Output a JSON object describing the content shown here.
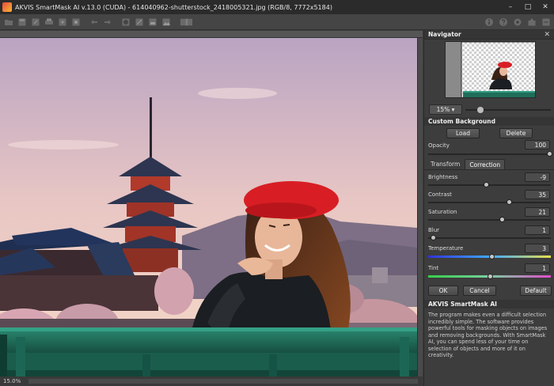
{
  "window": {
    "title": "AKVIS SmartMask AI v.13.0 (CUDA) - 614040962-shutterstock_2418005321.jpg (RGB/8, 7772x5184)",
    "minimize": "–",
    "maximize": "□",
    "close": "✕"
  },
  "toolbar": {
    "left_icons": [
      "open-icon",
      "save-icon",
      "save-as-icon",
      "print-icon",
      "export-icon",
      "batch-icon",
      "undo-icon",
      "redo-icon",
      "mask-icon",
      "cut-icon",
      "fill-icon",
      "image-icon",
      "compare-icon"
    ],
    "right_icons": [
      "info-icon",
      "help-icon",
      "settings-icon",
      "share-icon",
      "more-icon"
    ]
  },
  "status": {
    "zoom": "15.0%"
  },
  "navigator": {
    "title": "Navigator",
    "zoom": "15% ▾",
    "zoom_level": 0.14
  },
  "custom_background": {
    "title": "Custom Background",
    "load": "Load",
    "delete": "Delete",
    "opacity_label": "Opacity",
    "opacity_value": "100",
    "opacity_level": 1.0
  },
  "tabs": {
    "transform": "Transform",
    "correction": "Correction"
  },
  "correction": [
    {
      "label": "Brightness",
      "value": "-9",
      "level": 0.47
    },
    {
      "label": "Contrast",
      "value": "35",
      "level": 0.67
    },
    {
      "label": "Saturation",
      "value": "21",
      "level": 0.61
    },
    {
      "label": "Blur",
      "value": "1",
      "level": 0.02
    },
    {
      "label": "Temperature",
      "value": "3",
      "level": 0.52
    },
    {
      "label": "Tint",
      "value": "1",
      "level": 0.51
    }
  ],
  "actions": {
    "ok": "OK",
    "cancel": "Cancel",
    "default": "Default"
  },
  "info": {
    "title": "AKVIS SmartMask AI",
    "text": "The program makes even a difficult selection incredibly simple. The software provides powerful tools for masking objects on images and removing backgrounds. With SmartMask AI, you can spend less of your time on selection of objects and more of it on creativity."
  },
  "colors": {
    "panel_bg": "#3d3d3d",
    "title_bg": "#2b2b2b",
    "beret_red": "#d81e24",
    "bench_green": "#1f6e5a"
  }
}
